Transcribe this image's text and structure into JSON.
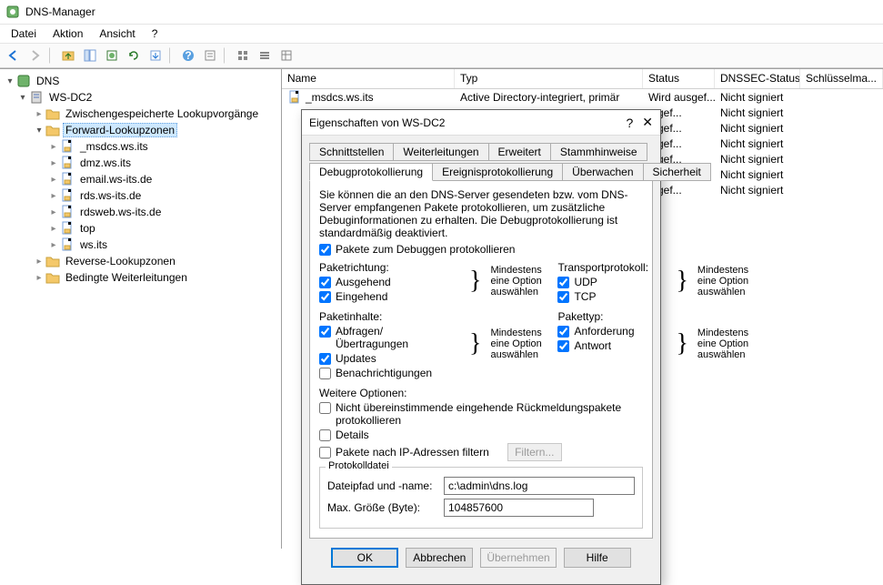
{
  "window": {
    "title": "DNS-Manager"
  },
  "menu": {
    "items": [
      "Datei",
      "Aktion",
      "Ansicht",
      "?"
    ]
  },
  "toolbar": {
    "buttons": [
      "back",
      "forward",
      "up",
      "show-hide",
      "new",
      "refresh",
      "export",
      "help",
      "prop1",
      "prop2",
      "list-s",
      "list-l",
      "list-d"
    ]
  },
  "tree": {
    "root": "DNS",
    "server": "WS-DC2",
    "nodes": [
      {
        "label": "Zwischengespeicherte Lookupvorgänge",
        "state": "closed",
        "icon": "folder",
        "depth": 2
      },
      {
        "label": "Forward-Lookupzonen",
        "state": "open",
        "icon": "folder",
        "depth": 2,
        "selected": true
      },
      {
        "label": "_msdcs.ws.its",
        "state": "closed",
        "icon": "zone",
        "depth": 3
      },
      {
        "label": "dmz.ws.its",
        "state": "closed",
        "icon": "zone",
        "depth": 3
      },
      {
        "label": "email.ws-its.de",
        "state": "closed",
        "icon": "zone",
        "depth": 3
      },
      {
        "label": "rds.ws-its.de",
        "state": "closed",
        "icon": "zone",
        "depth": 3
      },
      {
        "label": "rdsweb.ws-its.de",
        "state": "closed",
        "icon": "zone",
        "depth": 3
      },
      {
        "label": "top",
        "state": "closed",
        "icon": "zone",
        "depth": 3
      },
      {
        "label": "ws.its",
        "state": "closed",
        "icon": "zone",
        "depth": 3
      },
      {
        "label": "Reverse-Lookupzonen",
        "state": "closed",
        "icon": "folder",
        "depth": 2
      },
      {
        "label": "Bedingte Weiterleitungen",
        "state": "closed",
        "icon": "folder",
        "depth": 2
      }
    ]
  },
  "list": {
    "columns": [
      "Name",
      "Typ",
      "Status",
      "DNSSEC-Status",
      "Schlüsselma..."
    ],
    "rows": [
      {
        "name": "_msdcs.ws.its",
        "typ": "Active Directory-integriert, primär",
        "status": "Wird ausgef...",
        "dnssec": "Nicht signiert"
      },
      {
        "name": "",
        "typ": "",
        "status": "...gef...",
        "dnssec": "Nicht signiert"
      },
      {
        "name": "",
        "typ": "",
        "status": "...gef...",
        "dnssec": "Nicht signiert"
      },
      {
        "name": "",
        "typ": "",
        "status": "...gef...",
        "dnssec": "Nicht signiert"
      },
      {
        "name": "",
        "typ": "",
        "status": "...gef...",
        "dnssec": "Nicht signiert"
      },
      {
        "name": "",
        "typ": "",
        "status": "...gef...",
        "dnssec": "Nicht signiert"
      },
      {
        "name": "",
        "typ": "",
        "status": "...gef...",
        "dnssec": "Nicht signiert"
      }
    ]
  },
  "dialog": {
    "title": "Eigenschaften von WS-DC2",
    "tabs_row1": [
      "Schnittstellen",
      "Weiterleitungen",
      "Erweitert",
      "Stammhinweise"
    ],
    "tabs_row2": [
      "Debugprotokollierung",
      "Ereignisprotokollierung",
      "Überwachen",
      "Sicherheit"
    ],
    "active_tab": "Debugprotokollierung",
    "desc": "Sie können die an den DNS-Server gesendeten bzw. vom DNS-Server empfangenen Pakete protokollieren, um zusätzliche Debuginformationen zu erhalten. Die Debugprotokollierung ist standardmäßig deaktiviert.",
    "master_check": {
      "label": "Pakete zum Debuggen protokollieren",
      "checked": true
    },
    "hint": "Mindestens eine Option auswählen",
    "blocks": {
      "direction": {
        "title": "Paketrichtung:",
        "opts": [
          {
            "label": "Ausgehend",
            "checked": true
          },
          {
            "label": "Eingehend",
            "checked": true
          }
        ]
      },
      "transport": {
        "title": "Transportprotokoll:",
        "opts": [
          {
            "label": "UDP",
            "checked": true
          },
          {
            "label": "TCP",
            "checked": true
          }
        ]
      },
      "content": {
        "title": "Paketinhalte:",
        "opts": [
          {
            "label": "Abfragen/\nÜbertragungen",
            "checked": true
          },
          {
            "label": "Updates",
            "checked": true
          },
          {
            "label": "Benachrichtigungen",
            "checked": false
          }
        ]
      },
      "type": {
        "title": "Pakettyp:",
        "opts": [
          {
            "label": "Anforderung",
            "checked": true
          },
          {
            "label": "Antwort",
            "checked": true
          }
        ]
      }
    },
    "more": {
      "title": "Weitere Optionen:",
      "opts": [
        {
          "label": "Nicht übereinstimmende eingehende Rückmeldungspakete protokollieren",
          "checked": false
        },
        {
          "label": "Details",
          "checked": false
        },
        {
          "label": "Pakete nach IP-Adressen filtern",
          "checked": false
        }
      ],
      "filter_btn": "Filtern..."
    },
    "logfile": {
      "legend": "Protokolldatei",
      "path_label": "Dateipfad und -name:",
      "path_value": "c:\\admin\\dns.log",
      "size_label": "Max. Größe (Byte):",
      "size_value": "104857600"
    },
    "buttons": {
      "ok": "OK",
      "cancel": "Abbrechen",
      "apply": "Übernehmen",
      "help": "Hilfe"
    }
  }
}
